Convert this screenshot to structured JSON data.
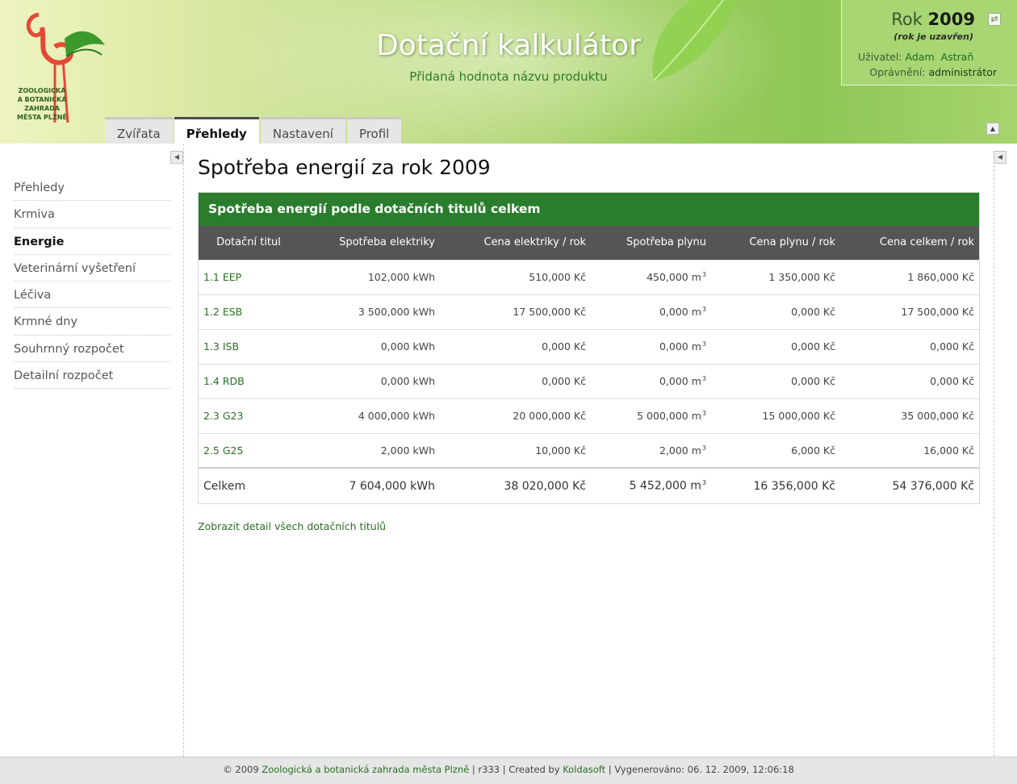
{
  "header": {
    "title": "Dotační kalkulátor",
    "subtitle": "Přidaná hodnota názvu produktu",
    "logo_lines": [
      "ZOOLOGICKÁ",
      "A BOTANICKÁ",
      "ZAHRADA",
      "MĚSTA PLZNĚ"
    ]
  },
  "userbox": {
    "year_label": "Rok",
    "year": "2009",
    "year_note": "(rok je uzavřen)",
    "user_label": "Uživatel:",
    "user_value": "Adam  Astraň",
    "permission_label": "Oprávnění:",
    "permission_value": "administrátor"
  },
  "tabs": [
    {
      "label": "Zvířata"
    },
    {
      "label": "Přehledy",
      "active": true
    },
    {
      "label": "Nastavení"
    },
    {
      "label": "Profil"
    }
  ],
  "sidebar": {
    "items": [
      {
        "label": "Přehledy"
      },
      {
        "label": "Krmiva"
      },
      {
        "label": "Energie",
        "active": true
      },
      {
        "label": "Veterinární vyšetření"
      },
      {
        "label": "Léčiva"
      },
      {
        "label": "Krmné dny"
      },
      {
        "label": "Souhrnný rozpočet"
      },
      {
        "label": "Detailní rozpočet"
      }
    ]
  },
  "main": {
    "page_title": "Spotřeba energií za rok 2009",
    "table_caption": "Spotřeba energií podle dotačních titulů celkem",
    "columns": [
      "Dotační titul",
      "Spotřeba elektriky",
      "Cena elektriky / rok",
      "Spotřeba plynu",
      "Cena plynu / rok",
      "Cena celkem / rok"
    ],
    "rows": [
      [
        "1.1 EEP",
        "102,000 kWh",
        "510,000 Kč",
        "450,000 m",
        "1 350,000 Kč",
        "1 860,000 Kč"
      ],
      [
        "1.2 ESB",
        "3 500,000 kWh",
        "17 500,000 Kč",
        "0,000 m",
        "0,000 Kč",
        "17 500,000 Kč"
      ],
      [
        "1.3 ISB",
        "0,000 kWh",
        "0,000 Kč",
        "0,000 m",
        "0,000 Kč",
        "0,000 Kč"
      ],
      [
        "1.4 RDB",
        "0,000 kWh",
        "0,000 Kč",
        "0,000 m",
        "0,000 Kč",
        "0,000 Kč"
      ],
      [
        "2.3 G23",
        "4 000,000 kWh",
        "20 000,000 Kč",
        "5 000,000 m",
        "15 000,000 Kč",
        "35 000,000 Kč"
      ],
      [
        "2.5 G25",
        "2,000 kWh",
        "10,000 Kč",
        "2,000 m",
        "6,000 Kč",
        "16,000 Kč"
      ]
    ],
    "total": [
      "Celkem",
      "7 604,000 kWh",
      "38 020,000 Kč",
      "5 452,000 m",
      "16 356,000 Kč",
      "54 376,000 Kč"
    ],
    "gas_unit_sup": "3",
    "detail_link": "Zobrazit detail všech dotačních titulů"
  },
  "footer": {
    "copyright": "© 2009",
    "org_link": "Zoologická a botanická zahrada města Plzně",
    "revision": "| r333 | Created by",
    "author_link": "Koldasoft",
    "generated": "| Vygenerováno: 06. 12. 2009, 12:06:18"
  },
  "colors": {
    "accent_green": "#2b7d2e",
    "link_green": "#2a6f24",
    "table_header": "#555555"
  }
}
